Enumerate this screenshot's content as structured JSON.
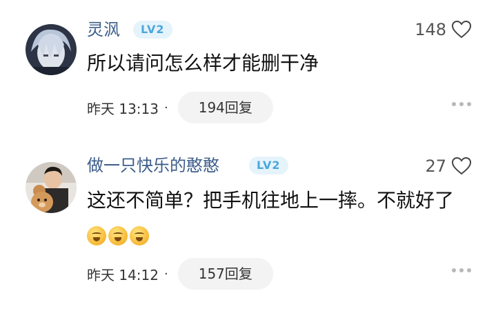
{
  "comments": [
    {
      "username": "灵沨",
      "level": "LV2",
      "likes": "148",
      "text": "所以请问怎么样才能删干净",
      "time": "昨天 13:13",
      "separator": "·",
      "replies": "194回复",
      "avatar_icon": "anime-avatar-icon",
      "emojis": []
    },
    {
      "username": "做一只快乐的憨憨",
      "level": "LV2",
      "likes": "27",
      "text": "这还不简单？把手机往地上一摔。不就好了",
      "time": "昨天 14:12",
      "separator": "·",
      "replies": "157回复",
      "avatar_icon": "person-with-teddy-bear-avatar-icon",
      "emojis": [
        "yawn-emoji-icon",
        "yawn-emoji-icon",
        "yawn-emoji-icon"
      ]
    }
  ],
  "colors": {
    "username": "#3c5d8a",
    "level_bg": "#e5f3fb",
    "level_text": "#4aa7dd",
    "reply_bg": "#f3f3f3"
  }
}
